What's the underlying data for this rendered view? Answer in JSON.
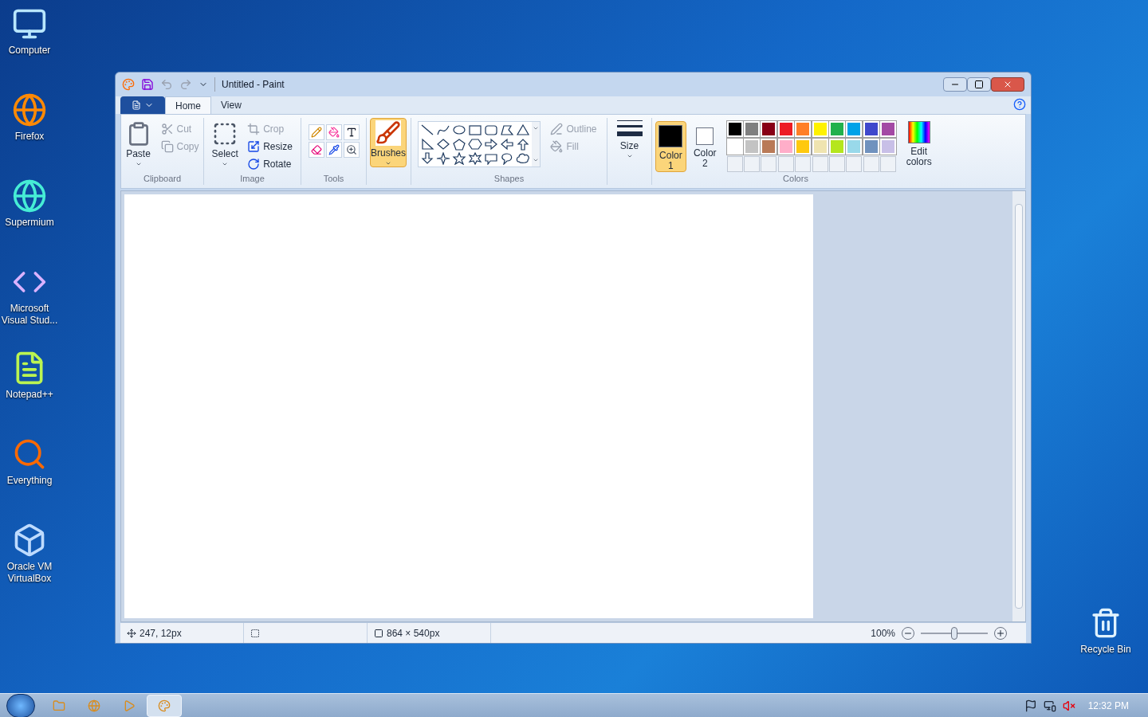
{
  "desktop_icons": [
    {
      "label": "Computer",
      "kind": "computer"
    },
    {
      "label": "Firefox",
      "kind": "browser"
    },
    {
      "label": "Supermium",
      "kind": "globe"
    },
    {
      "label": "Microsoft Visual Stud...",
      "kind": "ide"
    },
    {
      "label": "Notepad++",
      "kind": "notepad"
    },
    {
      "label": "Everything",
      "kind": "search"
    },
    {
      "label": "Oracle VM VirtualBox",
      "kind": "box"
    }
  ],
  "recycle_bin": {
    "label": "Recycle Bin"
  },
  "window": {
    "title": "Untitled - Paint",
    "quick_access": {
      "undo_disabled": true,
      "redo_disabled": true
    }
  },
  "tabs": [
    {
      "label": "Home",
      "selected": true
    },
    {
      "label": "View",
      "selected": false
    }
  ],
  "clipboard": {
    "paste": "Paste",
    "cut": {
      "label": "Cut",
      "disabled": true
    },
    "copy": {
      "label": "Copy",
      "disabled": true
    },
    "group": "Clipboard"
  },
  "image": {
    "select": "Select",
    "crop": {
      "label": "Crop",
      "disabled": true
    },
    "resize": {
      "label": "Resize",
      "disabled": false
    },
    "rotate": {
      "label": "Rotate",
      "disabled": false
    },
    "group": "Image"
  },
  "tools": {
    "group": "Tools"
  },
  "brushes": {
    "label": "Brushes",
    "selected": true
  },
  "shapes": {
    "group": "Shapes",
    "outline": {
      "label": "Outline",
      "disabled": true
    },
    "fill": {
      "label": "Fill",
      "disabled": true
    }
  },
  "size": {
    "label": "Size"
  },
  "color_slots": [
    {
      "label": "Color",
      "number": "1",
      "color": "#000000",
      "selected": true
    },
    {
      "label": "Color",
      "number": "2",
      "color": "#ffffff",
      "selected": false
    }
  ],
  "palette": [
    {
      "color": "#000000"
    },
    {
      "color": "#7f7f7f"
    },
    {
      "color": "#880015"
    },
    {
      "color": "#ed1c24"
    },
    {
      "color": "#ff7f27"
    },
    {
      "color": "#fff200"
    },
    {
      "color": "#22b14c"
    },
    {
      "color": "#00a2e8"
    },
    {
      "color": "#3f48cc"
    },
    {
      "color": "#a349a4"
    },
    {
      "color": "#ffffff"
    },
    {
      "color": "#c3c3c3"
    },
    {
      "color": "#b97a57"
    },
    {
      "color": "#ffaec9"
    },
    {
      "color": "#ffc90e"
    },
    {
      "color": "#efe4b0"
    },
    {
      "color": "#b5e61d"
    },
    {
      "color": "#99d9ea"
    },
    {
      "color": "#7092be"
    },
    {
      "color": "#c8bfe7"
    }
  ],
  "edit_colors": {
    "label": "Edit colors"
  },
  "colors_group": "Colors",
  "status_bar": {
    "position": "247, 12px",
    "canvas_size": "864 × 540px",
    "zoom": "100%",
    "zoom_slider": {
      "level": 0.5
    }
  },
  "taskbar": {
    "items": [
      {
        "kind": "folder",
        "selected": false
      },
      {
        "kind": "browser",
        "selected": false
      },
      {
        "kind": "media",
        "selected": false
      },
      {
        "kind": "paint",
        "selected": true
      }
    ],
    "clock": "12:32 PM"
  }
}
